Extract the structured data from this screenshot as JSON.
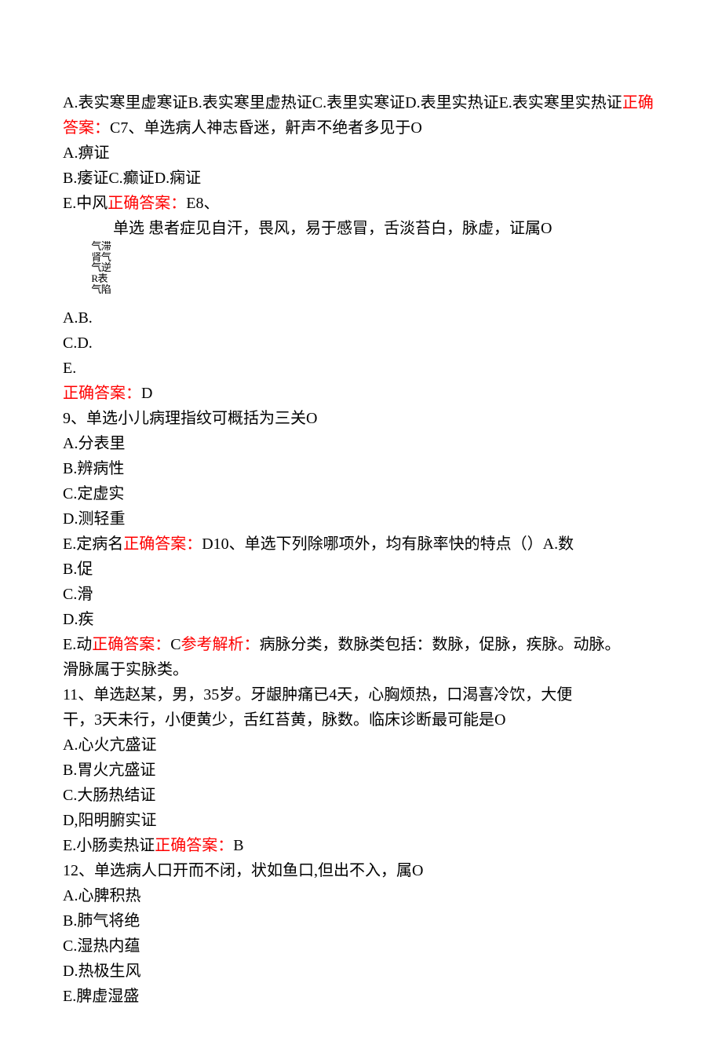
{
  "q6_tail": {
    "optA": "A.表实寒里虚寒证",
    "optB": "B.表实寒里虚热证",
    "optC": "C.表里实寒证",
    "optD": "D.表里实热证",
    "optE": "E.表实寒里实热证",
    "ans_label": "正确答案：",
    "ans_val": "C"
  },
  "q7": {
    "num_stem": "7、单选病人神志昏迷，鼾声不绝者多见于O",
    "optA": "A.痹证",
    "optB": "B.痿证",
    "optC": "C.癫证",
    "optD": "D.痫证",
    "optE": "E.中风",
    "ans_label": "正确答案：",
    "ans_val": "E"
  },
  "q8": {
    "num": "8、",
    "type_stem": "单选  患者症见自汗，畏风，易于感冒，舌淡苔白，脉虚，证属O",
    "stack": [
      "气滞",
      "肾气",
      "气逆",
      "R表",
      "气陷"
    ],
    "optAB": "A.B.",
    "optCD": "C.D.",
    "optE": "E.",
    "ans_label": "正确答案：",
    "ans_val": "D"
  },
  "q9": {
    "stem": "9、单选小儿病理指纹可概括为三关O",
    "optA": "A.分表里",
    "optB": "B.辨病性",
    "optC": "C.定虚实",
    "optD": "D.测轻重",
    "optE": "E.定病名",
    "ans_label": "正确答案：",
    "ans_val": "D"
  },
  "q10": {
    "num_stem": "10、单选下列除哪项外，均有脉率快的特点（）A.数",
    "optB": "B.促",
    "optC": "C.滑",
    "optD": "D.疾",
    "optE": "E.动",
    "ans_label": "正确答案：",
    "ans_val": "C",
    "explain_label": "参考解析：",
    "explain_1": "病脉分类，数脉类包括：数脉，促脉，疾脉。动脉。",
    "explain_2": "滑脉属于实脉类。"
  },
  "q11": {
    "stem1": "11、单选赵某，男，35岁。牙龈肿痛已4天，心胸烦热，口渴喜冷饮，大便",
    "stem2": "干，3天未行，小便黄少，舌红苔黄，脉数。临床诊断最可能是O",
    "optA": "A.心火亢盛证",
    "optB": "B.胃火亢盛证",
    "optC": "C.大肠热结证",
    "optD": "D,阳明腑实证",
    "optE": "E.小肠卖热证",
    "ans_label": "正确答案：",
    "ans_val": "B"
  },
  "q12": {
    "stem": "12、单选病人口开而不闭，状如鱼口,但出不入，属O",
    "optA": "A.心脾积热",
    "optB": "B.肺气将绝",
    "optC": "C.湿热内蕴",
    "optD": "D.热极生风",
    "optE": "E.脾虚湿盛"
  }
}
